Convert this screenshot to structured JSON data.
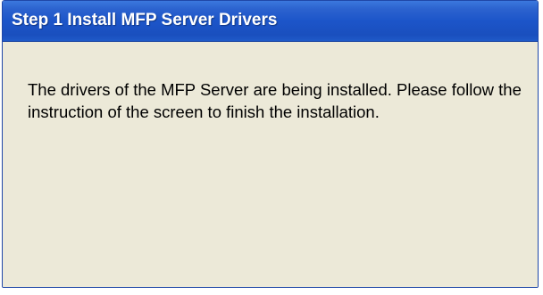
{
  "dialog": {
    "title": "Step 1 Install MFP Server Drivers",
    "message": "The drivers of the MFP Server are being installed. Please follow the instruction of the screen to finish the installation."
  },
  "colors": {
    "title_bar": "#1c55c9",
    "panel_background": "#ece9d8",
    "title_text": "#ffffff",
    "body_text": "#000000"
  }
}
